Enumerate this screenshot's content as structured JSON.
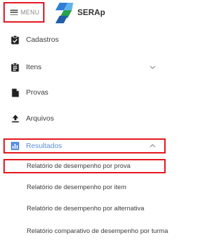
{
  "header": {
    "menu_label": "MENU",
    "brand": "SERAp",
    "icons": {
      "menu": "hamburger-icon",
      "logo": "serap-logo"
    }
  },
  "nav": {
    "items": [
      {
        "label": "Cadastros",
        "icon": "clipboard-check-icon",
        "expandable": false
      },
      {
        "label": "Itens",
        "icon": "clipboard-list-icon",
        "expandable": true
      },
      {
        "label": "Provas",
        "icon": "document-icon",
        "expandable": false
      },
      {
        "label": "Arquivos",
        "icon": "upload-icon",
        "expandable": false
      },
      {
        "label": "Resultados",
        "icon": "bar-chart-icon",
        "expandable": true,
        "expanded": true,
        "active": true
      }
    ],
    "sub_items": [
      {
        "label": "Relatório de desempenho por prova",
        "highlighted": true
      },
      {
        "label": "Relatório de desempenho por item"
      },
      {
        "label": "Relatório de desempenho por alternativa"
      },
      {
        "label": "Relatório comparativo de desempenho por turma"
      }
    ]
  },
  "colors": {
    "accent": "#5b8ee6",
    "highlight_border": "#e4131c",
    "text": "#3c3c3c"
  }
}
